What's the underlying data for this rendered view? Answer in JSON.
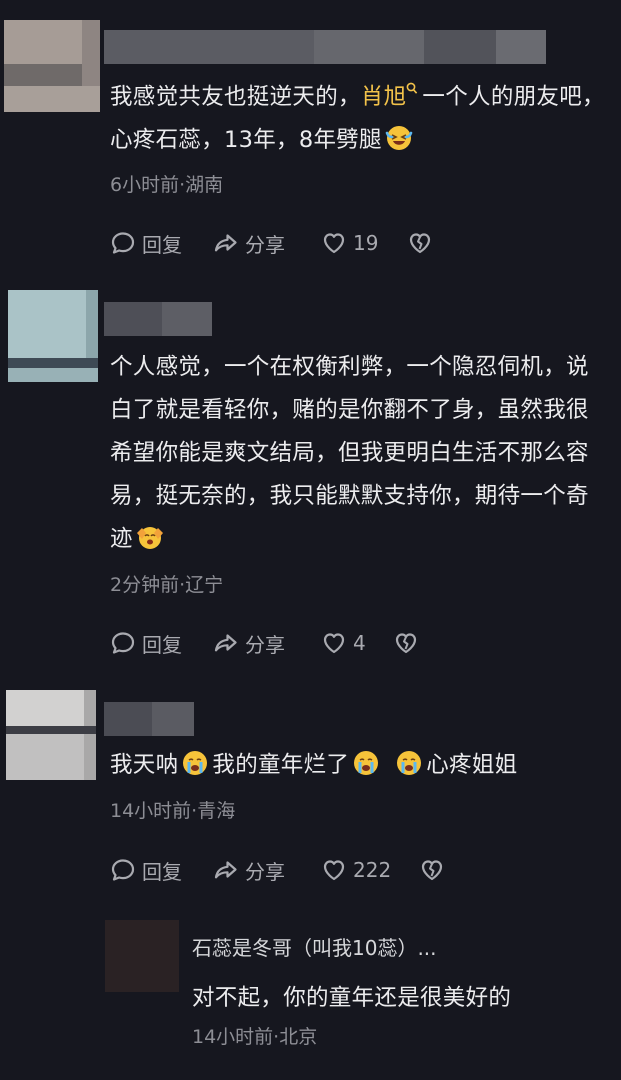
{
  "comments": [
    {
      "text_before": "我感觉共友也挺逆天的，",
      "mention": "肖旭",
      "text_after": "一个人的朋友吧，心疼石蕊，13年，8年劈腿",
      "emoji": "laughing-crying-emoji",
      "meta": "6小时前·湖南",
      "reply_label": "回复",
      "share_label": "分享",
      "likes": "19"
    },
    {
      "text": "个人感觉，一个在权衡利弊，一个隐忍伺机，说白了就是看轻你，赌的是你翻不了身，虽然我很希望你能是爽文结局，但我更明白生活不那么容易，挺无奈的，我只能默默支持你，期待一个奇迹",
      "emoji": "cheering-emoji",
      "meta": "2分钟前·辽宁",
      "reply_label": "回复",
      "share_label": "分享",
      "likes": "4"
    },
    {
      "part1": "我天呐",
      "part2": "我的童年烂了",
      "part3": "心疼姐姐",
      "emoji": "crying-face-emoji",
      "meta": "14小时前·青海",
      "reply_label": "回复",
      "share_label": "分享",
      "likes": "222"
    }
  ],
  "reply": {
    "author": "石蕊是冬哥（叫我10蕊）...",
    "text": "对不起，你的童年还是很美好的",
    "meta": "14小时前·北京"
  },
  "colors": {
    "background": "#16171f",
    "mention": "#f2c24a",
    "meta": "#8d8e95"
  }
}
